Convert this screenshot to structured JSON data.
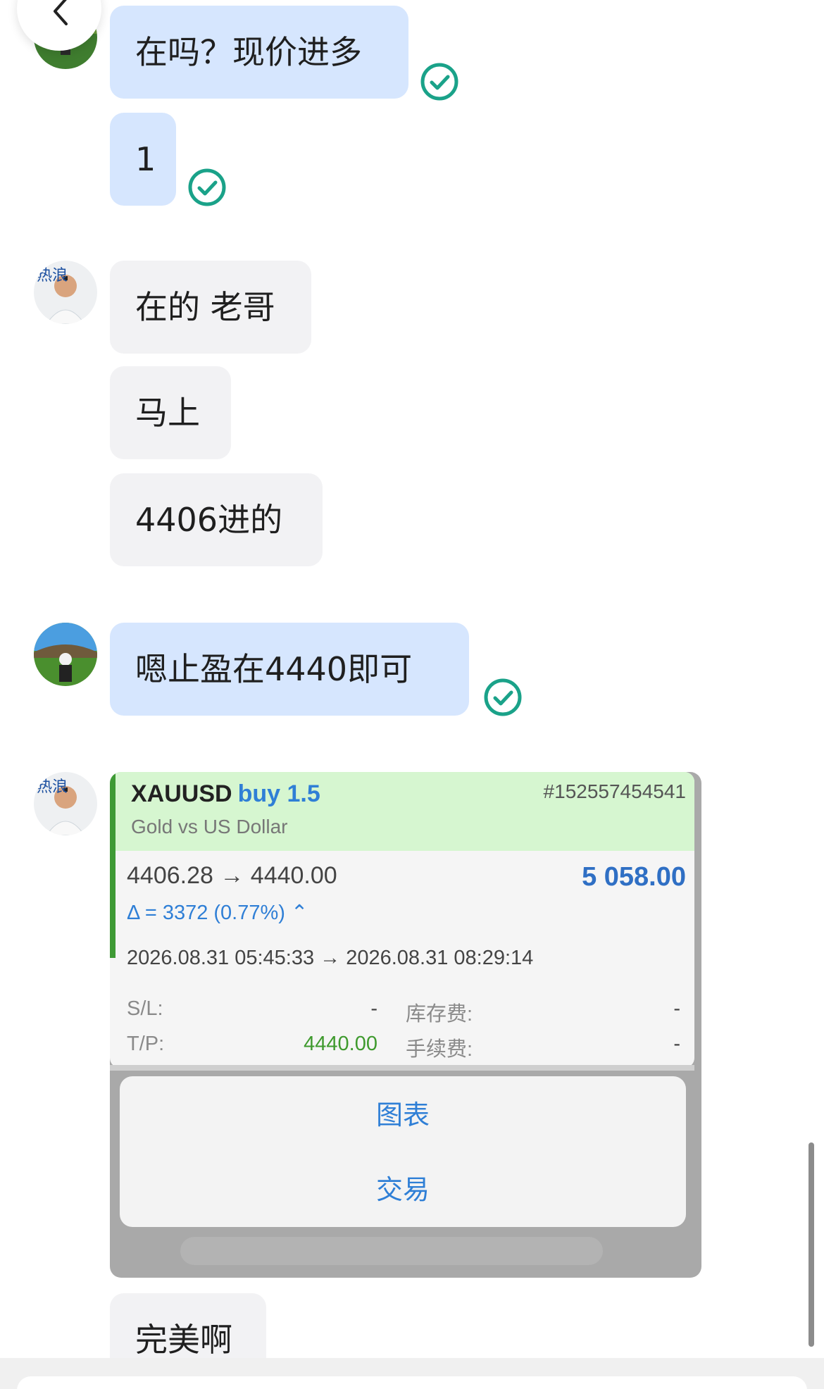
{
  "messages": [
    {
      "side": "me",
      "text": "在吗？现价进多"
    },
    {
      "side": "me",
      "text": "1"
    },
    {
      "side": "them",
      "text": "在的 老哥"
    },
    {
      "side": "them",
      "text": "马上"
    },
    {
      "side": "them",
      "text": "4406进的"
    },
    {
      "side": "me",
      "text": "嗯止盈在4440即可"
    },
    {
      "side": "them",
      "text": "完美啊"
    }
  ],
  "avatar_text": "热浪",
  "trade_card": {
    "symbol": "XAUUSD",
    "side": "buy 1.5",
    "ticket": "#152557454541",
    "instrument": "Gold vs US Dollar",
    "prices": "4406.28 → 4440.00",
    "profit": "5 058.00",
    "delta": "Δ = 3372 (0.77%) ⌃",
    "times": "2026.08.31 05:45:33 → 2026.08.31 08:29:14",
    "sl_label": "S/L:",
    "sl_value": "-",
    "tp_label": "T/P:",
    "tp_value": "4440.00",
    "swap_label": "库存费:",
    "swap_value": "-",
    "fee_label": "手续费:",
    "fee_value": "-",
    "menu": [
      "图表",
      "交易"
    ]
  },
  "colors": {
    "my_bubble": "#d6e6fe",
    "their_bubble": "#f2f2f4",
    "check": "#1aa289",
    "card_header": "#d6f6d0",
    "link_blue": "#2f7fd6",
    "tp_green": "#3f9a2e"
  }
}
